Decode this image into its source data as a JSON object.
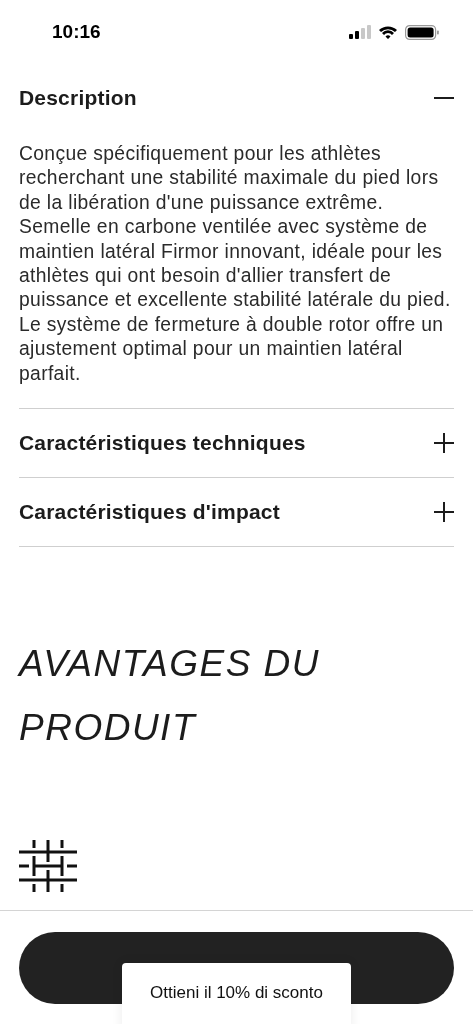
{
  "status_bar": {
    "time": "10:16"
  },
  "accordion": [
    {
      "title": "Description",
      "expanded": true,
      "body": "Conçue spécifiquement pour les athlètes recherchant une stabilité maximale du pied lors de la libération d'une puissance extrême. Semelle en carbone ventilée avec système de maintien latéral Firmor innovant, idéale pour les athlètes qui ont besoin d'allier transfert de puissance et excellente stabilité latérale du pied. Le système de fermeture à double rotor offre un ajustement optimal pour un maintien latéral parfait."
    },
    {
      "title": "Caractéristiques techniques",
      "expanded": false
    },
    {
      "title": "Caractéristiques d'impact",
      "expanded": false
    }
  ],
  "benefits": {
    "heading": "AVANTAGES DU PRODUIT"
  },
  "discount_popup": {
    "label": "Ottieni il 10% di sconto"
  }
}
